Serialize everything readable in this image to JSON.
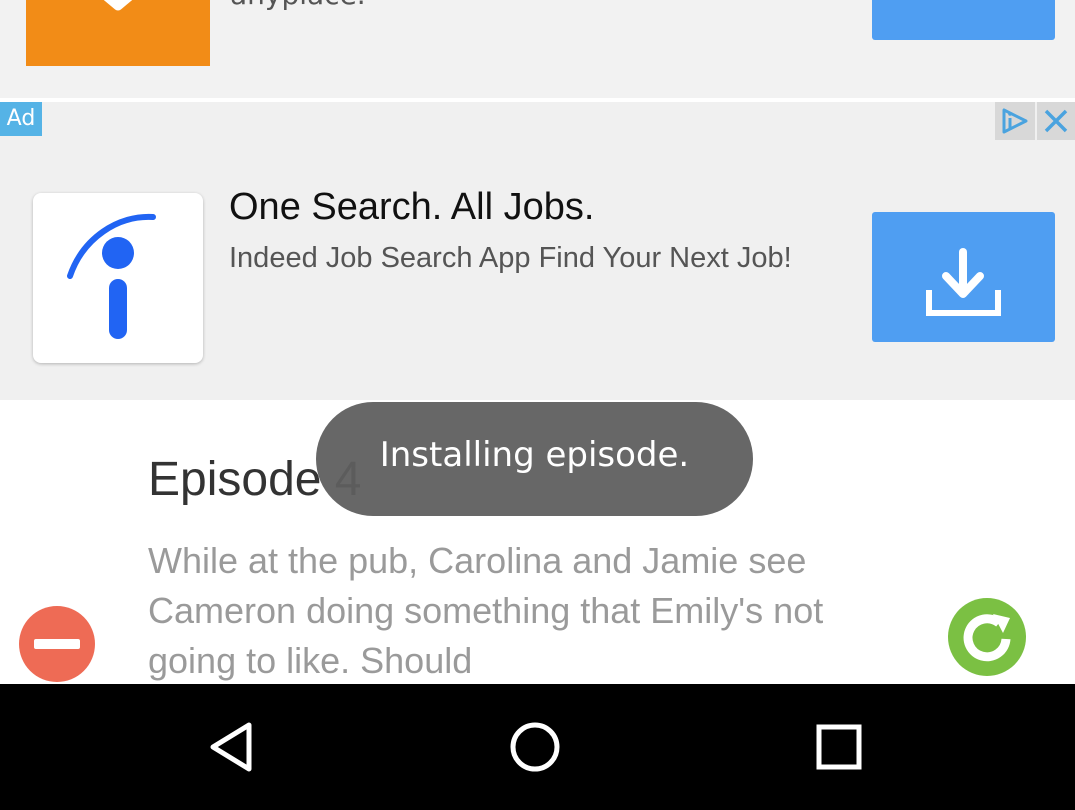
{
  "top_ad": {
    "text": "anyplace.",
    "icon": "orange-app-icon",
    "button_icon": "install-icon"
  },
  "ad": {
    "badge": "Ad",
    "choices_icon": "adchoices-icon",
    "close_icon": "close-icon",
    "app_icon": "indeed-logo-icon",
    "title": "One Search. All Jobs.",
    "description": "Indeed Job Search App Find Your Next Job!",
    "install_icon": "download-icon",
    "colors": {
      "background": "#f0f0f0",
      "button": "#4f9ef2",
      "badge": "#55b3e6",
      "logo": "#2164f3"
    }
  },
  "episode": {
    "title": "Episode 4",
    "description": "While at the pub, Carolina and Jamie see Cameron doing something that Emily's not going to like. Should",
    "remove_icon": "remove-icon",
    "refresh_icon": "refresh-icon",
    "colors": {
      "remove": "#ee6b55",
      "refresh": "#7bc043"
    }
  },
  "toast": {
    "message": "Installing episode."
  },
  "navbar": {
    "back_icon": "back-icon",
    "home_icon": "home-icon",
    "recents_icon": "recents-icon"
  }
}
